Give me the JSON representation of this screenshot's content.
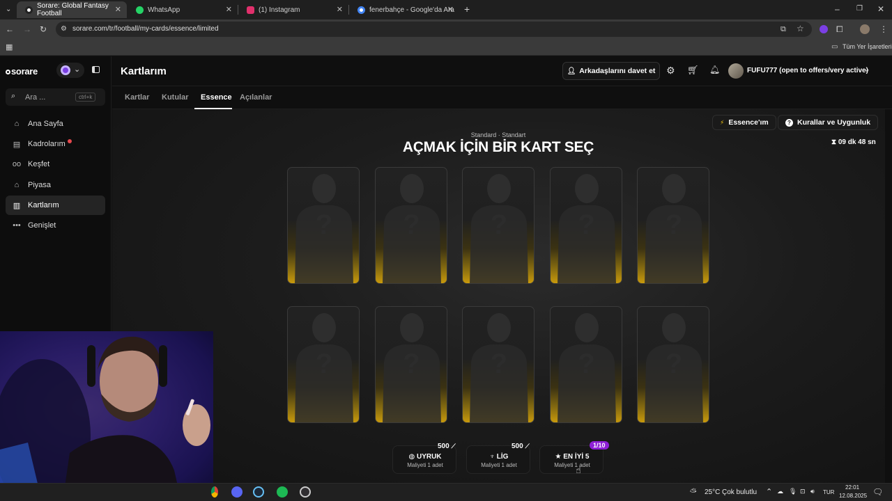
{
  "browser": {
    "tabs": [
      {
        "title": "Sorare: Global Fantasy Football",
        "active": true,
        "color": "#ffffff"
      },
      {
        "title": "WhatsApp",
        "active": false,
        "color": "#25d366"
      },
      {
        "title": "(1) Instagram",
        "active": false,
        "color": "#e1306c"
      },
      {
        "title": "fenerbahçe - Google'da Ara",
        "active": false,
        "color": "#4285f4"
      }
    ],
    "url": "sorare.com/tr/football/my-cards/essence/limited",
    "bookmarks_label": "Tüm Yer İşaretleri"
  },
  "sidebar": {
    "logo": "sorare",
    "search_placeholder": "Ara ...",
    "search_shortcut": "ctrl+k",
    "items": [
      {
        "label": "Ana Sayfa",
        "icon": "home-icon"
      },
      {
        "label": "Kadrolarım",
        "icon": "clipboard-icon",
        "badge": true
      },
      {
        "label": "Keşfet",
        "icon": "binoculars-icon"
      },
      {
        "label": "Piyasa",
        "icon": "store-icon"
      },
      {
        "label": "Kartlarım",
        "icon": "cards-icon",
        "active": true
      },
      {
        "label": "Genişlet",
        "icon": "more-icon"
      }
    ]
  },
  "header": {
    "title": "Kartlarım",
    "invite_label": "Arkadaşlarını davet et",
    "username": "FUFU777 (open to offers/very active)"
  },
  "subtabs": [
    {
      "label": "Kartlar"
    },
    {
      "label": "Kutular"
    },
    {
      "label": "Essence",
      "active": true
    },
    {
      "label": "Açılanlar"
    }
  ],
  "main": {
    "my_essence_label": "Essence'ım",
    "rules_label": "Kurallar ve Uygunluk",
    "timer": "09 dk 48 sn",
    "pretitle": "Standard · Standart",
    "title": "AÇMAK İÇİN BİR KART SEÇ",
    "card_placeholder": "?",
    "card_count": 10
  },
  "cost_options": [
    {
      "label": "UYRUK",
      "price": "500",
      "subtitle": "Maliyeti 1 adet",
      "icon": "globe-icon"
    },
    {
      "label": "LİG",
      "price": "500",
      "subtitle": "Maliyeti 1 adet",
      "icon": "trophy-icon"
    },
    {
      "label": "EN İYİ 5",
      "badge": "1/10",
      "subtitle": "Maliyeti 1 adet",
      "icon": "star-icon"
    }
  ],
  "taskbar": {
    "weather_temp": "25°C",
    "weather_text": "Çok bulutlu",
    "lang": "TUR",
    "time": "22:01",
    "date": "12.08.2025"
  },
  "colors": {
    "gold": "#c99a0c",
    "badge_purple": "#8e1fd6",
    "notification_red": "#e5484d"
  }
}
